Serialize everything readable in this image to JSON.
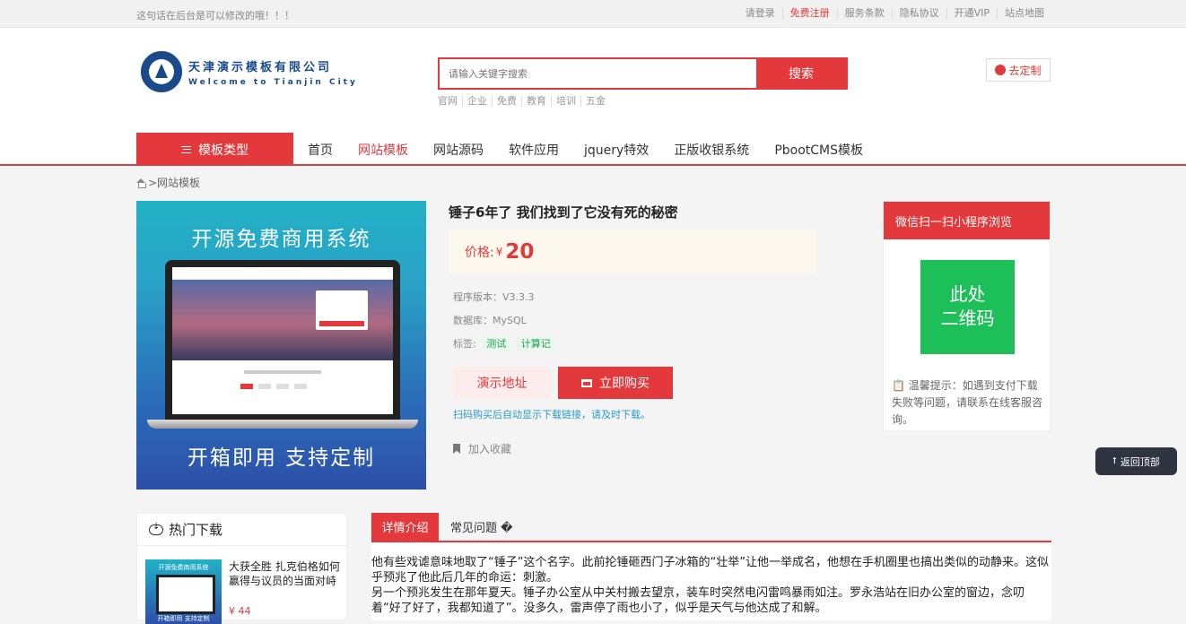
{
  "topbar": {
    "notice": "这句话在后台是可以修改的哦！！！",
    "links": [
      "请登录",
      "免费注册",
      "服务条款",
      "隐私协议",
      "开通VIP",
      "站点地图"
    ]
  },
  "header": {
    "logo_cn": "天津演示模板有限公司",
    "logo_en": "Welcome to Tianjin City",
    "search_placeholder": "请输入关键字搜索",
    "search_button": "搜索",
    "hotwords": [
      "官网",
      "企业",
      "免费",
      "教育",
      "培训",
      "五金"
    ],
    "custom_button": "去定制"
  },
  "nav": {
    "category": "模板类型",
    "items": [
      "首页",
      "网站模板",
      "网站源码",
      "软件应用",
      "jquery特效",
      "正版收银系统",
      "PbootCMS模板"
    ],
    "active_index": 1
  },
  "breadcrumb": ">网站模板",
  "product": {
    "image_top_text": "开源免费商用系统",
    "image_bottom_text": "开箱即用  支持定制",
    "title": "锤子6年了 我们找到了它没有死的秘密",
    "price_label": "价格:",
    "price_currency": "¥",
    "price_value": "20",
    "version": "程序版本：V3.3.3",
    "database": "数据库：MySQL",
    "tags_label": "标签:",
    "tags": [
      "测试",
      "计算记"
    ],
    "demo_button": "演示地址",
    "buy_button": "立即购买",
    "tip": "扫码购买后自动显示下载链接，请及时下载。",
    "favorite": "加入收藏"
  },
  "qr_panel": {
    "header": "微信扫一扫小程序浏览",
    "qr_line1": "此处",
    "qr_line2": "二维码",
    "tip": "温馨提示：如遇到支付下载失败等问题，请联系在线客服咨询。"
  },
  "back_top": "返回顶部",
  "hot": {
    "title": "热门下载",
    "item_thumb_top": "开源免费商用系统",
    "item_thumb_bottom": "开箱即用 支持定制",
    "item_title": "大获全胜 扎克伯格如何赢得与议员的当面对峙",
    "item_price": "¥ 44"
  },
  "detail": {
    "tabs": [
      "详情介绍",
      "常见问题 �"
    ],
    "para1": "他有些戏谑意味地取了“锤子”这个名字。此前抡锤砸西门子冰箱的“壮举”让他一举成名，他想在手机圈里也搞出类似的动静来。这似乎预兆了他此后几年的命运：刺激。",
    "para2": "另一个预兆发生在那年夏天。锤子办公室从中关村搬去望京，装车时突然电闪雷鸣暴雨如注。罗永浩站在旧办公室的窗边，念叨着“好了好了，我都知道了”。没多久，雷声停了雨也小了，似乎是天气与他达成了和解。"
  }
}
